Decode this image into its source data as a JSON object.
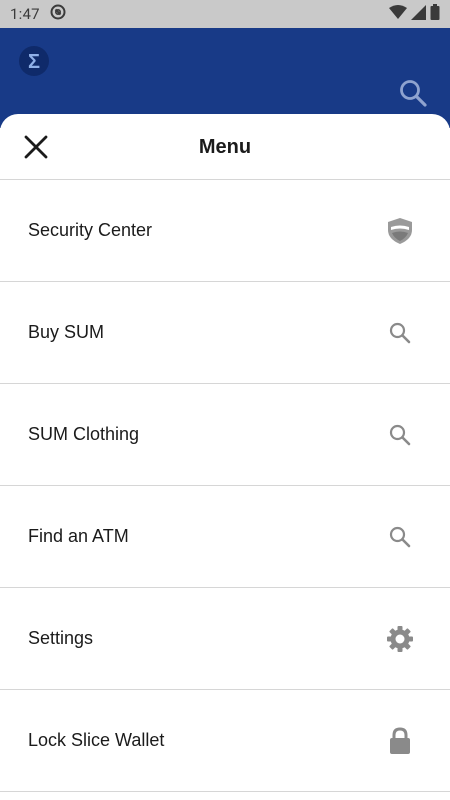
{
  "status_bar": {
    "time": "1:47"
  },
  "header": {
    "logo_glyph": "Σ"
  },
  "sheet": {
    "title": "Menu"
  },
  "menu": {
    "items": [
      {
        "label": "Security Center",
        "icon": "shield-icon"
      },
      {
        "label": "Buy SUM",
        "icon": "search-icon"
      },
      {
        "label": "SUM Clothing",
        "icon": "search-icon"
      },
      {
        "label": "Find an ATM",
        "icon": "search-icon"
      },
      {
        "label": "Settings",
        "icon": "gear-icon"
      },
      {
        "label": "Lock Slice Wallet",
        "icon": "lock-icon"
      }
    ]
  },
  "colors": {
    "header_bg": "#183a87",
    "icon_gray": "#8a8a8a",
    "status_bar_bg": "#c9c9c9"
  }
}
